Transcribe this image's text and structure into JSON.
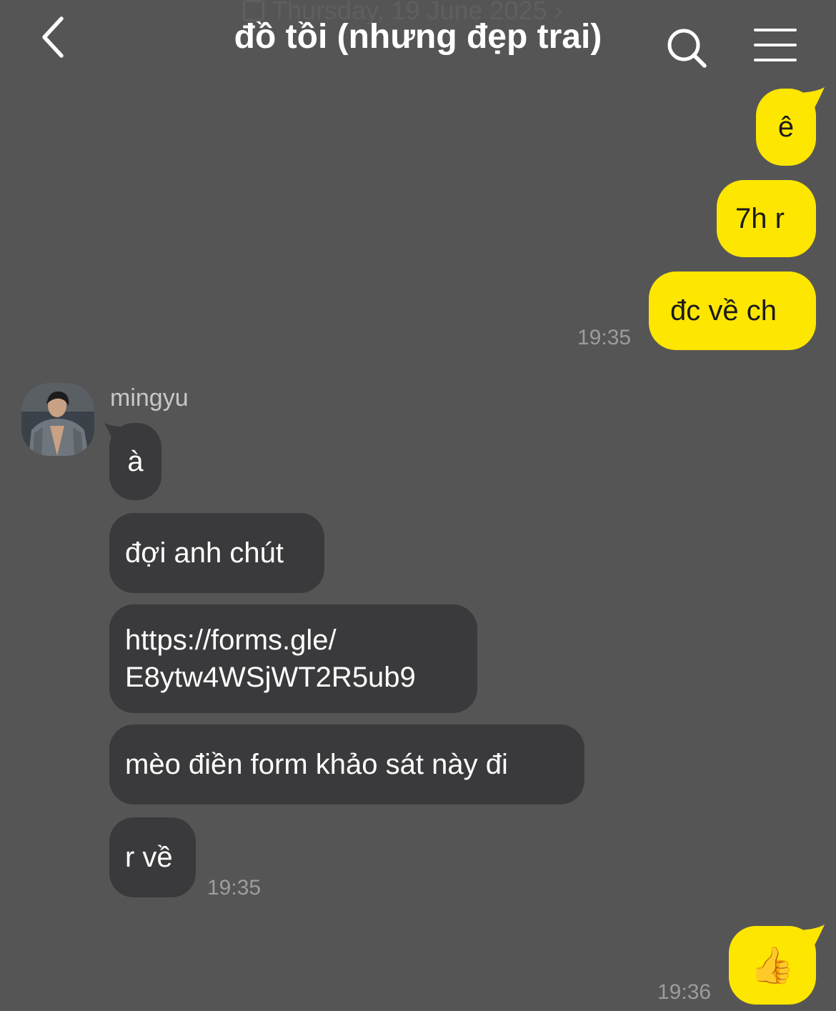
{
  "header": {
    "date_behind": "Thursday, 19 June 2025",
    "title": "đồ tồi (nhưng đẹp trai)"
  },
  "colors": {
    "background": "#565556",
    "my_bubble": "#fde600",
    "their_bubble": "#3a3a3c"
  },
  "messages": [
    {
      "from": "me",
      "text": "ê"
    },
    {
      "from": "me",
      "text": "7h r"
    },
    {
      "from": "me",
      "text": "đc về ch",
      "time": "19:35"
    },
    {
      "from": "mingyu",
      "sender": "mingyu",
      "text": "à"
    },
    {
      "from": "mingyu",
      "text": "đợi anh chút"
    },
    {
      "from": "mingyu",
      "text": "https://forms.gle/\nE8ytw4WSjWT2R5ub9"
    },
    {
      "from": "mingyu",
      "text": "mèo điền form khảo sát này đi"
    },
    {
      "from": "mingyu",
      "text": "r về",
      "time": "19:35"
    },
    {
      "from": "me",
      "text": "👍",
      "time": "19:36"
    }
  ]
}
